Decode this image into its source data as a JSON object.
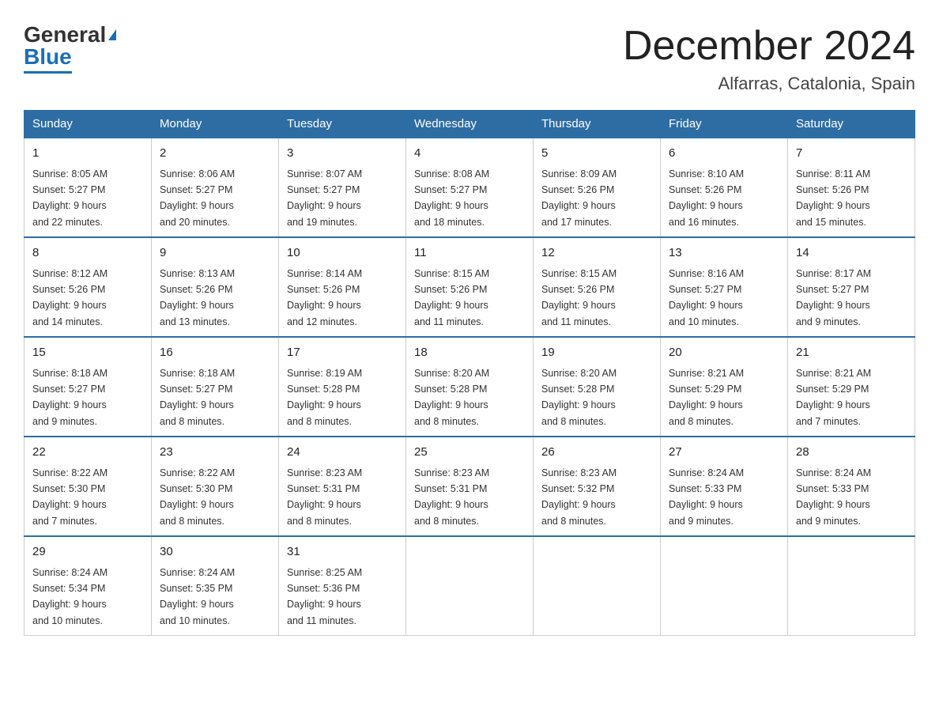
{
  "logo": {
    "general": "General",
    "blue": "Blue"
  },
  "header": {
    "month": "December 2024",
    "location": "Alfarras, Catalonia, Spain"
  },
  "days_of_week": [
    "Sunday",
    "Monday",
    "Tuesday",
    "Wednesday",
    "Thursday",
    "Friday",
    "Saturday"
  ],
  "weeks": [
    [
      {
        "day": "1",
        "info": "Sunrise: 8:05 AM\nSunset: 5:27 PM\nDaylight: 9 hours\nand 22 minutes."
      },
      {
        "day": "2",
        "info": "Sunrise: 8:06 AM\nSunset: 5:27 PM\nDaylight: 9 hours\nand 20 minutes."
      },
      {
        "day": "3",
        "info": "Sunrise: 8:07 AM\nSunset: 5:27 PM\nDaylight: 9 hours\nand 19 minutes."
      },
      {
        "day": "4",
        "info": "Sunrise: 8:08 AM\nSunset: 5:27 PM\nDaylight: 9 hours\nand 18 minutes."
      },
      {
        "day": "5",
        "info": "Sunrise: 8:09 AM\nSunset: 5:26 PM\nDaylight: 9 hours\nand 17 minutes."
      },
      {
        "day": "6",
        "info": "Sunrise: 8:10 AM\nSunset: 5:26 PM\nDaylight: 9 hours\nand 16 minutes."
      },
      {
        "day": "7",
        "info": "Sunrise: 8:11 AM\nSunset: 5:26 PM\nDaylight: 9 hours\nand 15 minutes."
      }
    ],
    [
      {
        "day": "8",
        "info": "Sunrise: 8:12 AM\nSunset: 5:26 PM\nDaylight: 9 hours\nand 14 minutes."
      },
      {
        "day": "9",
        "info": "Sunrise: 8:13 AM\nSunset: 5:26 PM\nDaylight: 9 hours\nand 13 minutes."
      },
      {
        "day": "10",
        "info": "Sunrise: 8:14 AM\nSunset: 5:26 PM\nDaylight: 9 hours\nand 12 minutes."
      },
      {
        "day": "11",
        "info": "Sunrise: 8:15 AM\nSunset: 5:26 PM\nDaylight: 9 hours\nand 11 minutes."
      },
      {
        "day": "12",
        "info": "Sunrise: 8:15 AM\nSunset: 5:26 PM\nDaylight: 9 hours\nand 11 minutes."
      },
      {
        "day": "13",
        "info": "Sunrise: 8:16 AM\nSunset: 5:27 PM\nDaylight: 9 hours\nand 10 minutes."
      },
      {
        "day": "14",
        "info": "Sunrise: 8:17 AM\nSunset: 5:27 PM\nDaylight: 9 hours\nand 9 minutes."
      }
    ],
    [
      {
        "day": "15",
        "info": "Sunrise: 8:18 AM\nSunset: 5:27 PM\nDaylight: 9 hours\nand 9 minutes."
      },
      {
        "day": "16",
        "info": "Sunrise: 8:18 AM\nSunset: 5:27 PM\nDaylight: 9 hours\nand 8 minutes."
      },
      {
        "day": "17",
        "info": "Sunrise: 8:19 AM\nSunset: 5:28 PM\nDaylight: 9 hours\nand 8 minutes."
      },
      {
        "day": "18",
        "info": "Sunrise: 8:20 AM\nSunset: 5:28 PM\nDaylight: 9 hours\nand 8 minutes."
      },
      {
        "day": "19",
        "info": "Sunrise: 8:20 AM\nSunset: 5:28 PM\nDaylight: 9 hours\nand 8 minutes."
      },
      {
        "day": "20",
        "info": "Sunrise: 8:21 AM\nSunset: 5:29 PM\nDaylight: 9 hours\nand 8 minutes."
      },
      {
        "day": "21",
        "info": "Sunrise: 8:21 AM\nSunset: 5:29 PM\nDaylight: 9 hours\nand 7 minutes."
      }
    ],
    [
      {
        "day": "22",
        "info": "Sunrise: 8:22 AM\nSunset: 5:30 PM\nDaylight: 9 hours\nand 7 minutes."
      },
      {
        "day": "23",
        "info": "Sunrise: 8:22 AM\nSunset: 5:30 PM\nDaylight: 9 hours\nand 8 minutes."
      },
      {
        "day": "24",
        "info": "Sunrise: 8:23 AM\nSunset: 5:31 PM\nDaylight: 9 hours\nand 8 minutes."
      },
      {
        "day": "25",
        "info": "Sunrise: 8:23 AM\nSunset: 5:31 PM\nDaylight: 9 hours\nand 8 minutes."
      },
      {
        "day": "26",
        "info": "Sunrise: 8:23 AM\nSunset: 5:32 PM\nDaylight: 9 hours\nand 8 minutes."
      },
      {
        "day": "27",
        "info": "Sunrise: 8:24 AM\nSunset: 5:33 PM\nDaylight: 9 hours\nand 9 minutes."
      },
      {
        "day": "28",
        "info": "Sunrise: 8:24 AM\nSunset: 5:33 PM\nDaylight: 9 hours\nand 9 minutes."
      }
    ],
    [
      {
        "day": "29",
        "info": "Sunrise: 8:24 AM\nSunset: 5:34 PM\nDaylight: 9 hours\nand 10 minutes."
      },
      {
        "day": "30",
        "info": "Sunrise: 8:24 AM\nSunset: 5:35 PM\nDaylight: 9 hours\nand 10 minutes."
      },
      {
        "day": "31",
        "info": "Sunrise: 8:25 AM\nSunset: 5:36 PM\nDaylight: 9 hours\nand 11 minutes."
      },
      {
        "day": "",
        "info": ""
      },
      {
        "day": "",
        "info": ""
      },
      {
        "day": "",
        "info": ""
      },
      {
        "day": "",
        "info": ""
      }
    ]
  ]
}
